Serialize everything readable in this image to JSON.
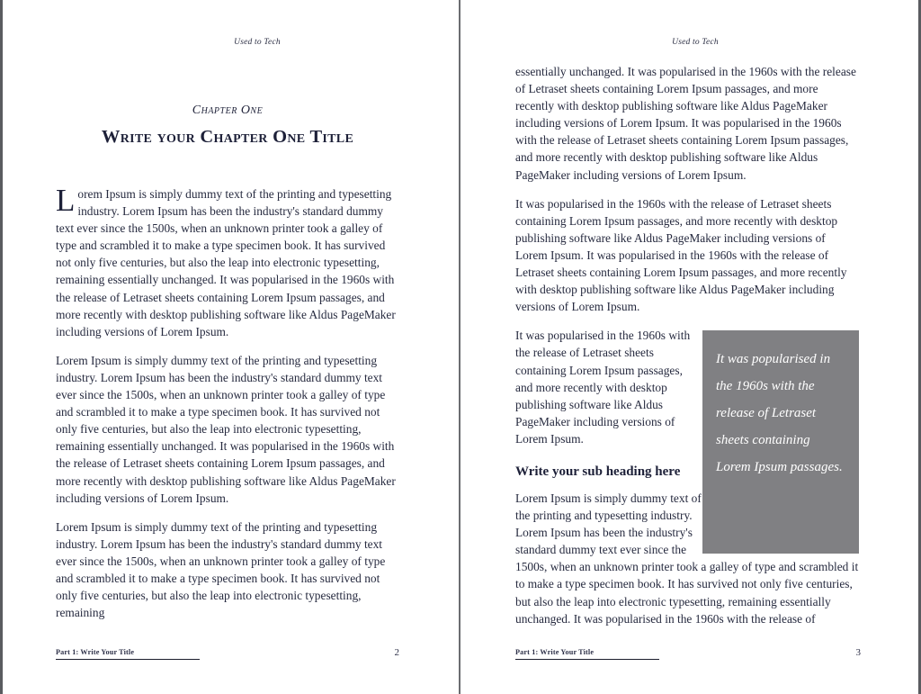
{
  "document": {
    "running_head": "Used to Tech",
    "footer_label": "Part 1: Write Your Title",
    "accent_color": "#262a3f",
    "pullquote_bg": "#808083"
  },
  "pages": [
    {
      "folio": "2",
      "chapter_eyebrow": "Chapter One",
      "chapter_title": "Write your Chapter One Title",
      "paragraphs": {
        "p1_dropcap": "L",
        "p1_rest": "orem Ipsum is simply dummy text of the printing and typesetting industry. Lorem Ipsum has been the industry's standard dummy text ever since the 1500s, when an unknown printer took a galley of type and scrambled it to make a type specimen book. It has survived not only five centuries, but also the leap into electronic typesetting, remaining essentially unchanged. It was popularised in the 1960s with the release of Letraset sheets containing Lorem Ipsum passages, and more recently with desktop publishing software like Aldus PageMaker including versions of Lorem Ipsum.",
        "p2": "Lorem Ipsum is simply dummy text of the printing and typesetting industry. Lorem Ipsum has been the industry's standard dummy text ever since the 1500s, when an unknown printer took a galley of type and scrambled it to make a type specimen book. It has survived not only five centuries, but also the leap into electronic typesetting, remaining essentially unchanged. It was popularised in the 1960s with the release of Letraset sheets containing Lorem Ipsum passages, and more recently with desktop publishing software like Aldus PageMaker including versions of Lorem Ipsum.",
        "p3": "Lorem Ipsum is simply dummy text of the printing and typesetting industry. Lorem Ipsum has been the industry's standard dummy text ever since the 1500s, when an unknown printer took a galley of type and scrambled it to make a type specimen book. It has survived not only five centuries, but also the leap into electronic typesetting, remaining"
      }
    },
    {
      "folio": "3",
      "subheading": "Write your sub heading here",
      "pullquote": "It was popularised in the 1960s with the release of Letraset sheets containing Lorem Ipsum passages.",
      "paragraphs": {
        "p1": "essentially unchanged. It was popularised in the 1960s with the release of Letraset sheets containing Lorem Ipsum passages, and more recently with desktop publishing software like Aldus PageMaker including versions of Lorem Ipsum. It was popularised in the 1960s with the release of Letraset sheets containing Lorem Ipsum passages, and more recently with desktop publishing software like Aldus PageMaker including versions of Lorem Ipsum.",
        "p2": "It was popularised in the 1960s with the release of Letraset sheets containing Lorem Ipsum passages, and more recently with desktop publishing software like Aldus PageMaker including versions of Lorem Ipsum.  It was popularised in the 1960s with the release of Letraset sheets containing Lorem Ipsum passages, and more recently with desktop publishing software like Aldus PageMaker including versions of Lorem Ipsum.",
        "p3": "It was popularised in the 1960s with the release of Letraset sheets containing Lorem Ipsum passages, and more recently with desktop publishing software like Aldus PageMaker including versions of Lorem Ipsum.",
        "p4": "Lorem Ipsum is simply dummy text of the printing and typesetting industry. Lorem Ipsum has been the industry's standard dummy text ever since the 1500s, when an unknown printer took a galley of type and scrambled it to make a type specimen book. It has survived not only five centuries, but also the leap into electronic typesetting, remaining essentially unchanged. It was popularised in the 1960s with the release of"
      }
    }
  ]
}
